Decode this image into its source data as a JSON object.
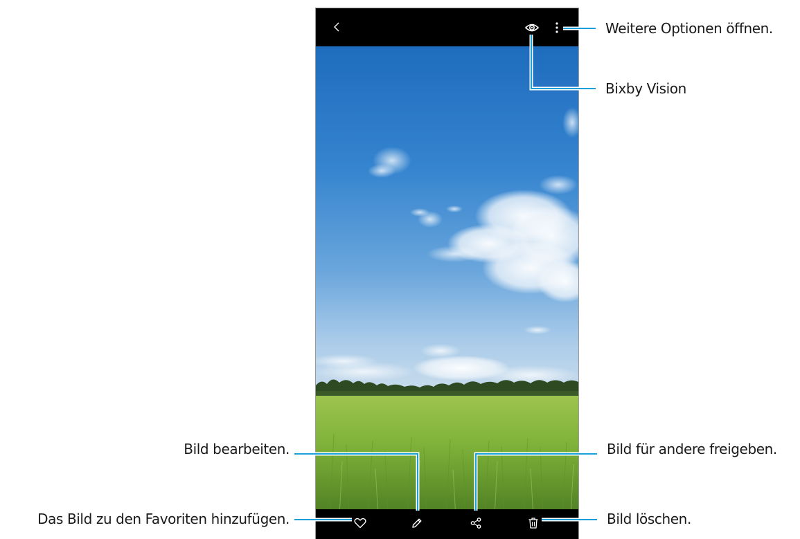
{
  "toolbar": {
    "back_icon": "chevron-left-icon",
    "bixby_icon": "eye-icon",
    "more_icon": "more-vertical-icon"
  },
  "bottom_bar": {
    "favorite_icon": "heart-icon",
    "edit_icon": "pencil-icon",
    "share_icon": "share-icon",
    "delete_icon": "trash-icon"
  },
  "callouts": {
    "more_options": "Weitere Optionen öffnen.",
    "bixby_vision": "Bixby Vision",
    "edit": "Bild bearbeiten.",
    "share": "Bild für andere freigeben.",
    "favorite": "Das Bild zu den Favoriten hinzufügen.",
    "delete": "Bild löschen."
  },
  "colors": {
    "callout_line": "#1aa0d8",
    "bar_background": "#000000",
    "sky_top": "#1d6fc0",
    "grass": "#7fb23a"
  }
}
